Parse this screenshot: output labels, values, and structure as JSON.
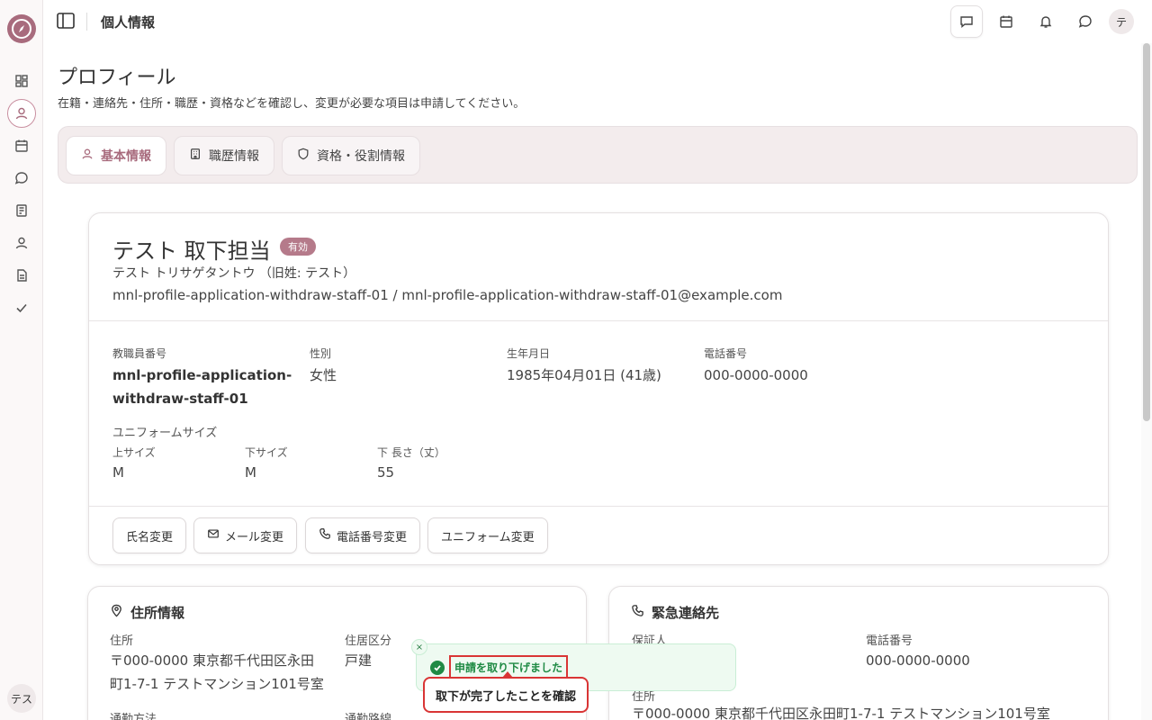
{
  "header": {
    "title": "個人情報",
    "user_initial": "テ"
  },
  "sidebar": {
    "user_label": "テス"
  },
  "page": {
    "title": "プロフィール",
    "description": "在籍・連絡先・住所・職歴・資格などを確認し、変更が必要な項目は申請してください。"
  },
  "tabs": [
    {
      "label": "基本情報",
      "active": true
    },
    {
      "label": "職歴情報",
      "active": false
    },
    {
      "label": "資格・役割情報",
      "active": false
    }
  ],
  "profile": {
    "name": "テスト 取下担当",
    "status_badge": "有効",
    "kana": "テスト トリサゲタントウ （旧姓: テスト）",
    "ids": "mnl-profile-application-withdraw-staff-01 / mnl-profile-application-withdraw-staff-01@example.com",
    "fields": {
      "staff_no_label": "教職員番号",
      "staff_no_line1": "mnl-profile-application-",
      "staff_no_line2": "withdraw-staff-01",
      "gender_label": "性別",
      "gender": "女性",
      "birth_label": "生年月日",
      "birth": "1985年04月01日 (41歳)",
      "phone_label": "電話番号",
      "phone": "000-0000-0000"
    },
    "uniform": {
      "section_label": "ユニフォームサイズ",
      "top_label": "上サイズ",
      "top": "M",
      "bottom_label": "下サイズ",
      "bottom": "M",
      "length_label": "下 長さ（丈）",
      "length": "55"
    },
    "actions": {
      "name_change": "氏名変更",
      "mail_change": "メール変更",
      "phone_change": "電話番号変更",
      "uniform_change": "ユニフォーム変更"
    }
  },
  "address_card": {
    "title": "住所情報",
    "address_label": "住所",
    "address_line1": "〒000-0000 東京都千代田区永田",
    "address_line2": "町1-7-1 テストマンション101号室",
    "residence_label": "住居区分",
    "residence": "戸建",
    "commute_label": "通勤方法",
    "route_label": "通勤路線"
  },
  "emergency_card": {
    "title": "緊急連絡先",
    "guarantor_label": "保証人",
    "phone_label": "電話番号",
    "phone": "000-0000-0000",
    "address_label": "住所",
    "address": "〒000-0000 東京都千代田区永田町1-7-1 テストマンション101号室"
  },
  "toast": {
    "message": "申請を取り下げました",
    "close": "×",
    "callout": "取下が完了したことを確認"
  },
  "colors": {
    "accent": "#a86b7d",
    "success": "#1f8a44",
    "highlight": "#d93535"
  }
}
